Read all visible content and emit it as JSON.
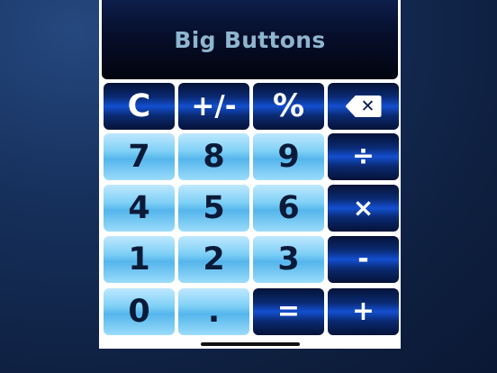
{
  "display": {
    "text": "Big Buttons"
  },
  "keys": [
    {
      "label": "C",
      "name": "clear-button"
    },
    {
      "label": "+/-",
      "name": "plus-minus-button"
    },
    {
      "label": "%",
      "name": "percent-button"
    },
    {
      "label": "",
      "name": "backspace-button",
      "icon": "backspace-icon"
    },
    {
      "label": "7",
      "name": "digit-7-button"
    },
    {
      "label": "8",
      "name": "digit-8-button"
    },
    {
      "label": "9",
      "name": "digit-9-button"
    },
    {
      "label": "÷",
      "name": "divide-button"
    },
    {
      "label": "4",
      "name": "digit-4-button"
    },
    {
      "label": "5",
      "name": "digit-5-button"
    },
    {
      "label": "6",
      "name": "digit-6-button"
    },
    {
      "label": "×",
      "name": "multiply-button"
    },
    {
      "label": "1",
      "name": "digit-1-button"
    },
    {
      "label": "2",
      "name": "digit-2-button"
    },
    {
      "label": "3",
      "name": "digit-3-button"
    },
    {
      "label": "-",
      "name": "minus-button"
    },
    {
      "label": "0",
      "name": "digit-0-button"
    },
    {
      "label": ".",
      "name": "decimal-button"
    },
    {
      "label": "=",
      "name": "equals-button"
    },
    {
      "label": "+",
      "name": "plus-button"
    }
  ],
  "colors": {
    "dark_key": "#0a2a72",
    "light_key": "#55b5ec",
    "display_text": "#8fb5cf"
  }
}
